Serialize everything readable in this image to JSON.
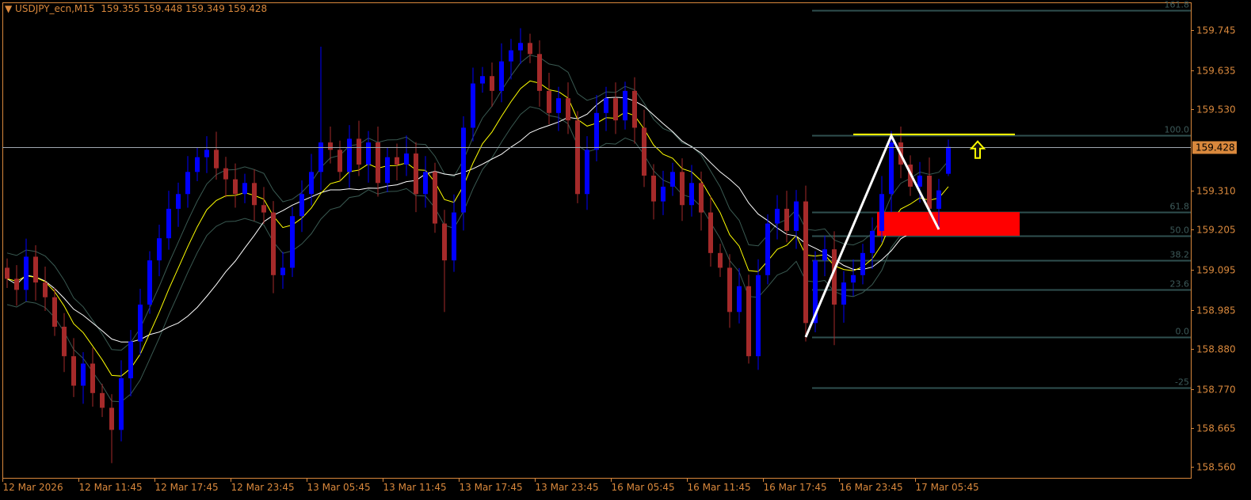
{
  "header": {
    "symbol": "USDJPY_ecn,M15",
    "ohlc": "159.355 159.448 159.349 159.428"
  },
  "colors": {
    "background": "#000000",
    "axis": "#d9883c",
    "bull": "#0000ff",
    "bear": "#a52a2a",
    "fib": "#2f4f4f",
    "ema_fast": "#ffff00",
    "ma_slow": "#ffffff",
    "bands": "#3a5a52",
    "zone": "#ff0000",
    "price_line": "#a0a8b0"
  },
  "chart_data": {
    "type": "candlestick",
    "title": "USDJPY_ecn,M15",
    "ylim": [
      158.505,
      159.84
    ],
    "current_price": "159.428",
    "y_ticks": [
      "159.745",
      "159.635",
      "159.530",
      "159.310",
      "159.205",
      "159.095",
      "158.985",
      "158.880",
      "158.770",
      "158.665",
      "158.560"
    ],
    "x_ticks": [
      "12 Mar 2026",
      "12 Mar 11:45",
      "12 Mar 17:45",
      "12 Mar 23:45",
      "13 Mar 05:45",
      "13 Mar 11:45",
      "13 Mar 17:45",
      "13 Mar 23:45",
      "16 Mar 05:45",
      "16 Mar 11:45",
      "16 Mar 17:45",
      "16 Mar 23:45",
      "17 Mar 05:45"
    ],
    "bars_per_tick": 8,
    "closes": [
      159.07,
      159.04,
      159.13,
      159.06,
      159.02,
      158.94,
      158.86,
      158.78,
      158.84,
      158.76,
      158.72,
      158.66,
      158.8,
      158.9,
      159.0,
      159.12,
      159.18,
      159.26,
      159.3,
      159.36,
      159.4,
      159.42,
      159.37,
      159.34,
      159.3,
      159.33,
      159.27,
      159.25,
      159.08,
      159.1,
      159.24,
      159.3,
      159.36,
      159.44,
      159.42,
      159.36,
      159.45,
      159.38,
      159.44,
      159.33,
      159.4,
      159.38,
      159.41,
      159.3,
      159.36,
      159.22,
      159.12,
      159.25,
      159.48,
      159.6,
      159.62,
      159.58,
      159.66,
      159.69,
      159.71,
      159.68,
      159.58,
      159.52,
      159.56,
      159.5,
      159.3,
      159.42,
      159.52,
      159.56,
      159.5,
      159.58,
      159.48,
      159.35,
      159.28,
      159.32,
      159.36,
      159.27,
      159.33,
      159.25,
      159.14,
      159.1,
      158.98,
      159.05,
      158.86,
      159.08,
      159.22,
      159.26,
      159.2,
      159.28,
      158.95,
      159.12,
      159.15,
      159.0,
      159.06,
      159.08,
      159.14,
      159.2,
      159.3,
      159.44,
      159.38,
      159.32,
      159.35,
      159.26,
      159.31,
      159.428
    ],
    "first_open": 159.1,
    "extremes": [
      {
        "i": 11,
        "low": 158.57
      },
      {
        "i": 33,
        "high": 159.7
      },
      {
        "i": 46,
        "low": 158.98
      },
      {
        "i": 54,
        "high": 159.75
      },
      {
        "i": 78,
        "low": 158.84
      },
      {
        "i": 84,
        "low": 158.9
      },
      {
        "i": 87,
        "low": 158.89
      },
      {
        "i": 99,
        "open": 159.355,
        "high": 159.448,
        "low": 159.349
      }
    ],
    "fibonacci": {
      "price_0": 158.912,
      "price_100": 159.46,
      "levels": [
        {
          "ratio": 1.618,
          "label": "161.8"
        },
        {
          "ratio": 1.0,
          "label": "100.0"
        },
        {
          "ratio": 0.618,
          "label": "61.8"
        },
        {
          "ratio": 0.5,
          "label": "50.0"
        },
        {
          "ratio": 0.382,
          "label": "38.2"
        },
        {
          "ratio": 0.236,
          "label": "23.6"
        },
        {
          "ratio": 0.0,
          "label": "0.0"
        },
        {
          "ratio": -0.25,
          "label": "-25"
        }
      ]
    },
    "zigzag": [
      {
        "bar": 84,
        "price": 158.912
      },
      {
        "bar": 93,
        "price": 159.458
      },
      {
        "bar": 98,
        "price": 159.204
      }
    ],
    "resistance_line": {
      "price": 159.462,
      "from_bar": 89,
      "to_bar": 106
    },
    "zone": {
      "top": 159.251,
      "bottom": 159.187,
      "from_bar": 92,
      "to_bar": 107
    },
    "arrow": {
      "direction": "up",
      "bar": 102,
      "price": 159.43
    }
  }
}
